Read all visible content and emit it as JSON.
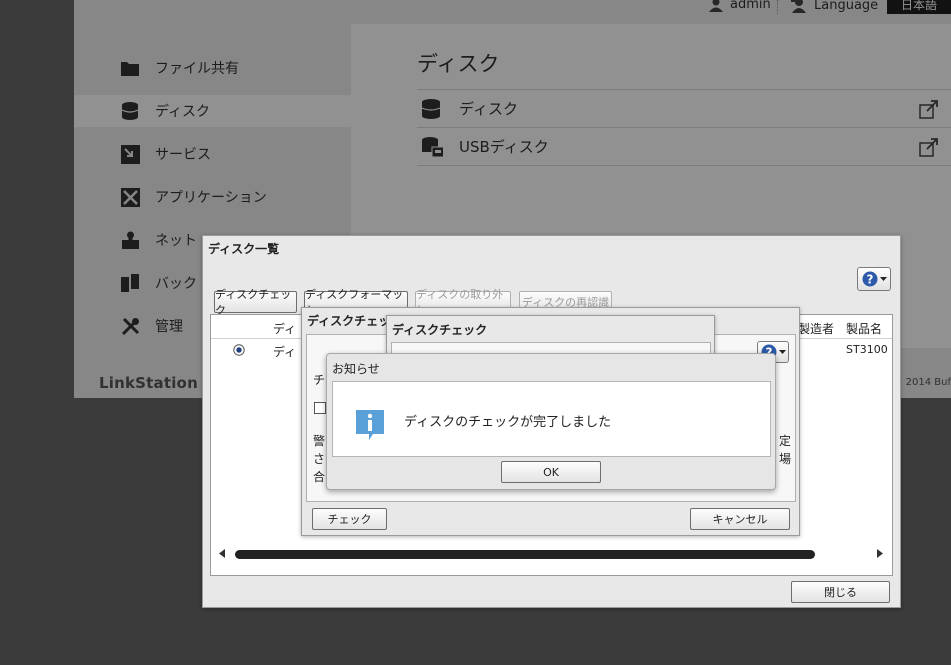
{
  "topbar": {
    "user": "admin",
    "language_label": "Language",
    "language_value": "日本語"
  },
  "sidebar": {
    "items": [
      {
        "label": "ファイル共有",
        "icon": "folder-icon"
      },
      {
        "label": "ディスク",
        "icon": "disk-icon"
      },
      {
        "label": "サービス",
        "icon": "service-icon"
      },
      {
        "label": "アプリケーション",
        "icon": "application-icon"
      },
      {
        "label": "ネット",
        "icon": "network-icon"
      },
      {
        "label": "バック",
        "icon": "backup-icon"
      },
      {
        "label": "管理",
        "icon": "tools-icon"
      }
    ],
    "active_index": 1
  },
  "content": {
    "title": "ディスク",
    "rows": [
      {
        "label": "ディスク",
        "icon": "disk-icon"
      },
      {
        "label": "USBディスク",
        "icon": "usb-disk-icon"
      }
    ]
  },
  "footer": {
    "logo": "LinkStation",
    "copyright": "© 2014 Buf"
  },
  "disk_list_dialog": {
    "title": "ディスク一覧",
    "buttons": {
      "check": "ディスクチェック",
      "format": "ディスクフォーマット",
      "remove": "ディスクの取り外し",
      "rediscover": "ディスクの再認識"
    },
    "columns": {
      "disk": "ディ",
      "maker": "製造者",
      "product": "製品名"
    },
    "row": {
      "disk": "ディ",
      "product": "ST3100"
    },
    "close": "閉じる"
  },
  "check_option_dialog": {
    "title": "ディスクチェッ",
    "text_line1": "チ",
    "warn_1": "警",
    "warn_2": "さ",
    "warn_3": "合",
    "right_1": "定",
    "right_2": "場",
    "check_button": "チェック",
    "cancel_button": "キャンセル"
  },
  "diskcheck_dialog": {
    "title": "ディスクチェック"
  },
  "notice_dialog": {
    "title": "お知らせ",
    "message": "ディスクのチェックが完了しました",
    "ok": "OK"
  },
  "colors": {
    "overlay": "#000000",
    "info_icon": "#5aa0d8"
  }
}
